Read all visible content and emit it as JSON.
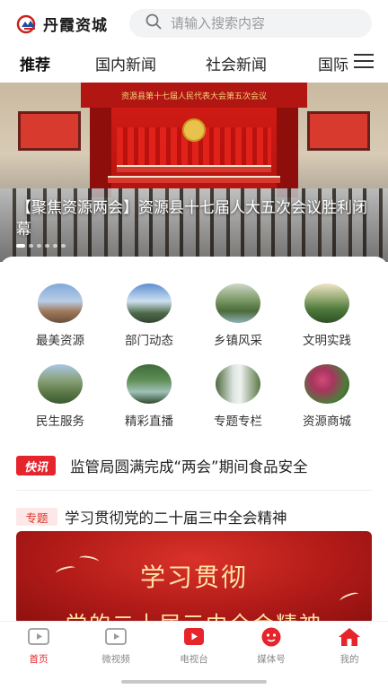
{
  "header": {
    "logo_text": "丹霞资城",
    "search_placeholder": "请输入搜索内容"
  },
  "tabs": [
    {
      "label": "推荐",
      "active": true
    },
    {
      "label": "国内新闻",
      "active": false
    },
    {
      "label": "社会新闻",
      "active": false
    },
    {
      "label": "国际",
      "active": false
    }
  ],
  "banner": {
    "stage_title": "资源县第十七届人民代表大会第五次会议",
    "caption": "【聚焦资源两会】资源县十七届人大五次会议胜利闭幕",
    "slide_count": 6,
    "active_slide": 1
  },
  "grid": [
    {
      "label": "最美资源",
      "icon": "scenic-town-icon"
    },
    {
      "label": "部门动态",
      "icon": "mountain-sky-icon"
    },
    {
      "label": "乡镇风采",
      "icon": "river-valley-icon"
    },
    {
      "label": "文明实践",
      "icon": "green-hills-icon"
    },
    {
      "label": "民生服务",
      "icon": "rock-peak-icon"
    },
    {
      "label": "精彩直播",
      "icon": "forest-stream-icon"
    },
    {
      "label": "专题专栏",
      "icon": "waterfall-icon"
    },
    {
      "label": "资源商城",
      "icon": "flower-icon"
    }
  ],
  "quick_news": {
    "badge": "快讯",
    "text": "监管局圆满完成“两会”期间食品安全"
  },
  "topic": {
    "badge": "专题",
    "title": "学习贯彻党的二十届三中全会精神",
    "poster_line1": "学习贯彻",
    "poster_line2": "党的二十届三中全会精神"
  },
  "bottom_nav": [
    {
      "label": "首页",
      "active": true
    },
    {
      "label": "微视频",
      "active": false
    },
    {
      "label": "电视台",
      "active": false
    },
    {
      "label": "媒体号",
      "active": false
    },
    {
      "label": "我的",
      "active": false
    }
  ],
  "colors": {
    "accent": "#e5242b",
    "search_bg": "#f2f3f5",
    "text": "#222222"
  }
}
